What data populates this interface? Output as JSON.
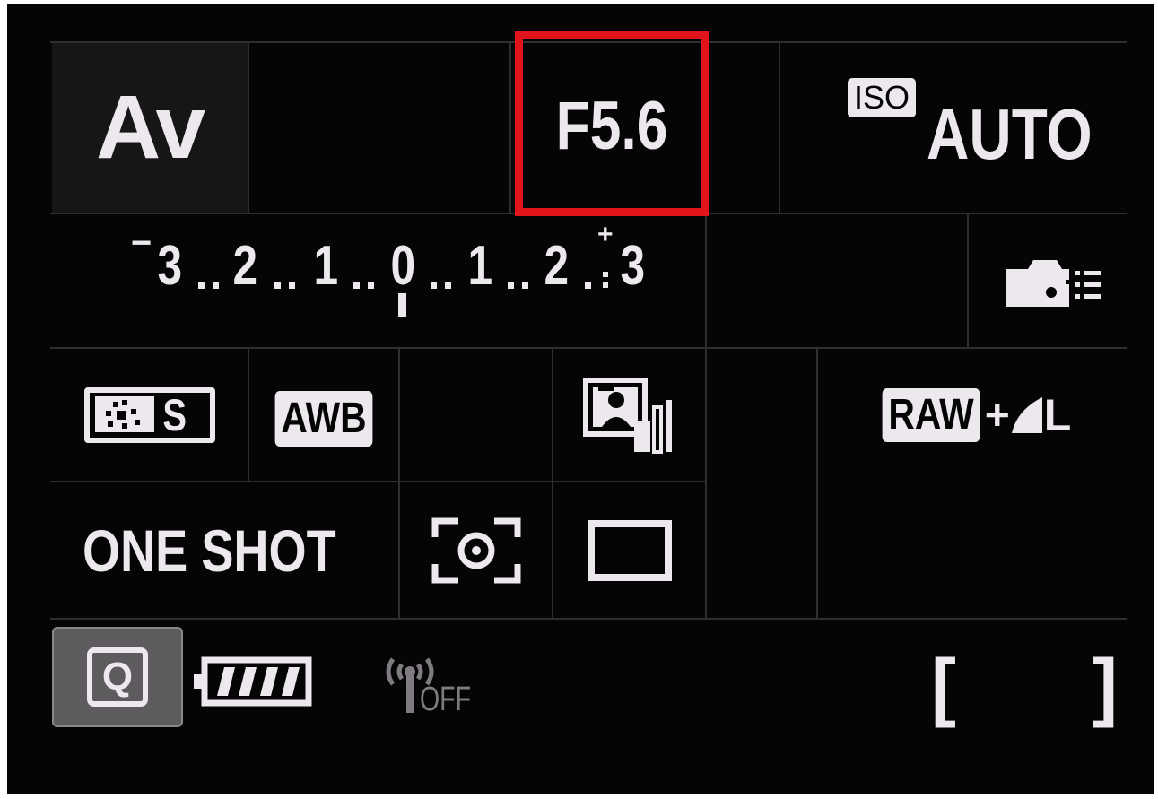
{
  "shooting_mode": "Av",
  "aperture": {
    "value": "F5.6",
    "highlight_color": "#e0141a"
  },
  "iso": {
    "badge": "ISO",
    "value": "AUTO"
  },
  "exposure_compensation": {
    "scale_labels": [
      "3",
      "2",
      "1",
      "0",
      "1",
      "2",
      "3"
    ],
    "minus_sign": "−",
    "plus_sign": "+",
    "current_value": 0
  },
  "custom_controls_icon": "camera-menu-icon",
  "picture_style": {
    "icon": "picture-style-icon",
    "label": "S"
  },
  "white_balance": {
    "label": "AWB"
  },
  "auto_lighting_optimizer": {
    "icon": "auto-lighting-optimizer-icon"
  },
  "image_quality": {
    "raw": "RAW",
    "plus": "+",
    "jpeg_size": "L"
  },
  "af_operation": {
    "label": "ONE SHOT"
  },
  "metering_mode": {
    "icon": "evaluative-metering-icon"
  },
  "drive_mode": {
    "icon": "single-shot-icon"
  },
  "quick_control": {
    "label": "Q"
  },
  "battery": {
    "level_bars": 4,
    "max_bars": 4
  },
  "wireless": {
    "label": "OFF"
  },
  "shots_remaining": {
    "open_bracket": "[",
    "close_bracket": "]"
  },
  "colors": {
    "background": "#050505",
    "text": "#ece8ee",
    "gridline": "#2e2e2e",
    "highlight": "#e0141a"
  }
}
